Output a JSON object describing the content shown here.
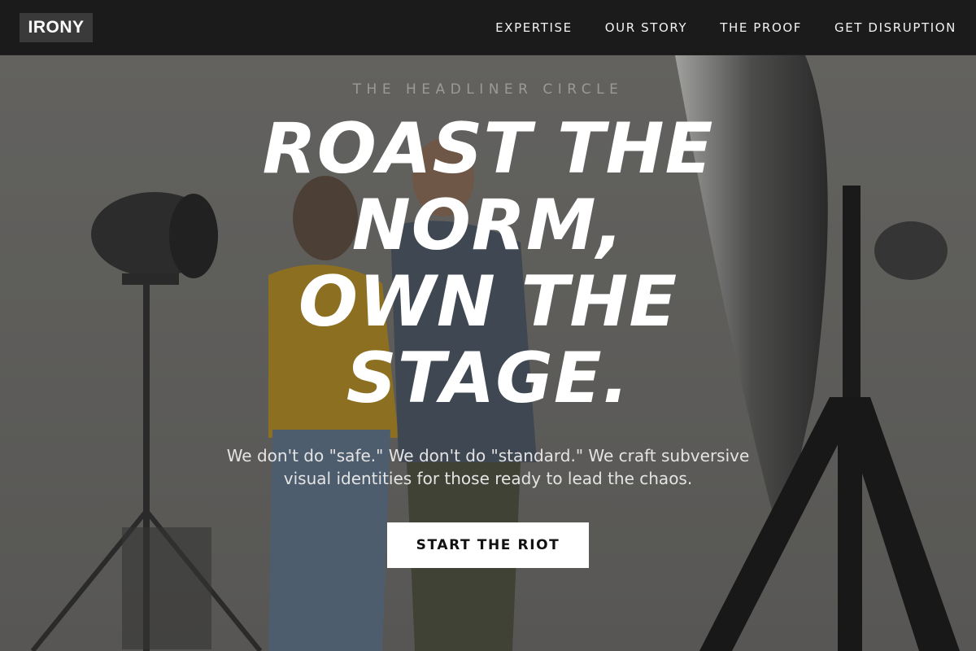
{
  "nav": {
    "logo": "IRONY",
    "links": [
      "EXPERTISE",
      "OUR STORY",
      "THE PROOF",
      "GET DISRUPTION"
    ]
  },
  "hero": {
    "eyebrow": "THE HEADLINER CIRCLE",
    "headline_lines": [
      "ROAST THE",
      "NORM,",
      "OWN THE",
      "STAGE."
    ],
    "subhead": "We don't do \"safe.\" We don't do \"standard.\" We craft subversive visual identities for those ready to lead the chaos.",
    "cta_label": "START THE RIOT",
    "background_image": "photo of two people in a photo studio with lighting equipment"
  },
  "colors": {
    "navbar_bg": "#1b1b1b",
    "logo_bg": "#3a3a3a",
    "text_light": "#ffffff",
    "cta_bg": "#ffffff",
    "cta_text": "#111111"
  }
}
